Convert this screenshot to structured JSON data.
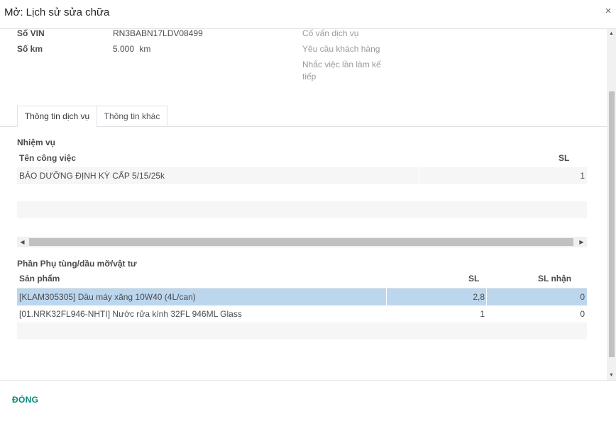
{
  "dialog": {
    "title": "Mở: Lịch sử sửa chữa",
    "close_glyph": "×"
  },
  "fields": {
    "vin_label": "Số VIN",
    "vin_value": "RN3BABN17LDV08499",
    "km_label": "Số km",
    "km_value": "5.000",
    "km_unit": "km",
    "advisor_label": "Cố vấn dịch vụ",
    "customer_request_label": "Yêu cầu khách hàng",
    "next_reminder_label_line1": "Nhắc việc lần làm kế",
    "next_reminder_label_line2": "tiếp"
  },
  "tabs": [
    {
      "label": "Thông tin dịch vụ",
      "active": true
    },
    {
      "label": "Thông tin khác",
      "active": false
    }
  ],
  "tasks": {
    "section_title": "Nhiệm vụ",
    "columns": {
      "name": "Tên công việc",
      "qty": "SL"
    },
    "rows": [
      {
        "name": "BẢO DƯỠNG ĐỊNH KỲ CẤP 5/15/25k",
        "qty": "1"
      }
    ]
  },
  "parts": {
    "section_title": "Phần Phụ tùng/dầu mỡ/vật tư",
    "columns": {
      "product": "Sản phẩm",
      "qty": "SL",
      "qty_received": "SL nhận"
    },
    "rows": [
      {
        "product": "[KLAM305305] Dầu máy xăng 10W40 (4L/can)",
        "qty": "2,8",
        "qty_received": "0",
        "selected": true
      },
      {
        "product": "[01.NRK32FL946-NHTI] Nước rửa kính 32FL 946ML Glass",
        "qty": "1",
        "qty_received": "0",
        "selected": false
      }
    ]
  },
  "scroll": {
    "left_arrow": "◀",
    "right_arrow": "▶",
    "up_arrow": "▲",
    "down_arrow": "▼"
  },
  "footer": {
    "close_button_label": "ĐÓNG"
  },
  "colors": {
    "accent": "#00897b",
    "selected_row": "#bcd6ee",
    "stripe": "#f6f6f6"
  }
}
